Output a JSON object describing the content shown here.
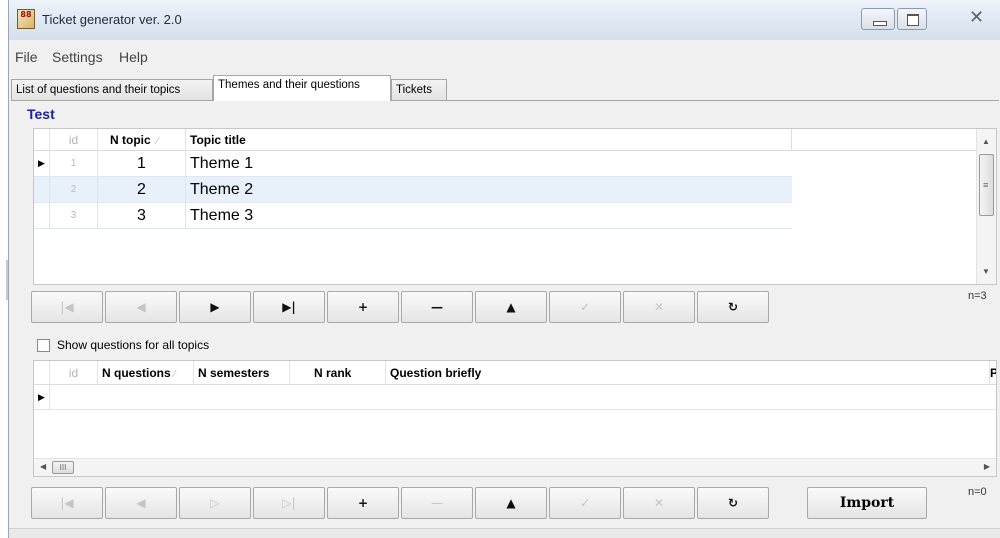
{
  "window": {
    "title": "Ticket generator ver. 2.0",
    "icon_name": "app-icon",
    "icon_text": "88",
    "controls": [
      "minimize-icon",
      "maximize-icon",
      "close-icon"
    ],
    "close_glyph": "✕"
  },
  "menu": {
    "items": [
      "File",
      "Settings",
      "Help"
    ]
  },
  "tabs": [
    {
      "label": "List of questions and their topics",
      "active": false
    },
    {
      "label": "Themes and their questions",
      "active": true
    },
    {
      "label": "Tickets",
      "active": false
    }
  ],
  "group_title": "Test",
  "topics_grid": {
    "columns": [
      {
        "key": "id",
        "label": "id"
      },
      {
        "key": "n_topic",
        "label": "N topic",
        "sort_mark": "⁄"
      },
      {
        "key": "topic_title",
        "label": "Topic title"
      }
    ],
    "rows": [
      {
        "id": "1",
        "n_topic": "1",
        "topic_title": "Theme 1",
        "current": true,
        "selected": false
      },
      {
        "id": "2",
        "n_topic": "2",
        "topic_title": "Theme 2",
        "current": false,
        "selected": true
      },
      {
        "id": "3",
        "n_topic": "3",
        "topic_title": "Theme 3",
        "current": false,
        "selected": false
      }
    ],
    "record_count": "n=3",
    "navigator": [
      {
        "name": "first-record-icon",
        "glyph": "|◀",
        "enabled": false
      },
      {
        "name": "prior-record-icon",
        "glyph": "◀",
        "enabled": false
      },
      {
        "name": "next-record-icon",
        "glyph": "▶",
        "enabled": true
      },
      {
        "name": "last-record-icon",
        "glyph": "▶|",
        "enabled": true
      },
      {
        "name": "insert-record-icon",
        "glyph": "+",
        "enabled": true
      },
      {
        "name": "delete-record-icon",
        "glyph": "—",
        "enabled": true
      },
      {
        "name": "edit-record-icon",
        "glyph": "▲",
        "enabled": true
      },
      {
        "name": "post-record-icon",
        "glyph": "✓",
        "enabled": false
      },
      {
        "name": "cancel-record-icon",
        "glyph": "✕",
        "enabled": false
      },
      {
        "name": "refresh-icon",
        "glyph": "↻",
        "enabled": true
      }
    ]
  },
  "show_all_checkbox": {
    "label": "Show questions for all topics",
    "checked": false
  },
  "questions_grid": {
    "columns": [
      {
        "key": "id",
        "label": "id"
      },
      {
        "key": "n_questions",
        "label": "N questions",
        "sort_mark": "⁄"
      },
      {
        "key": "n_semesters",
        "label": "N semesters"
      },
      {
        "key": "n_rank",
        "label": "N rank"
      },
      {
        "key": "question_briefly",
        "label": "Question briefly"
      },
      {
        "key": "p",
        "label": "P"
      }
    ],
    "rows": [],
    "scroll_thumb_glyph": "III",
    "record_count": "n=0",
    "navigator": [
      {
        "name": "first-record-icon",
        "glyph": "|◀",
        "enabled": false
      },
      {
        "name": "prior-record-icon",
        "glyph": "◀",
        "enabled": false
      },
      {
        "name": "next-record-icon",
        "glyph": "▷",
        "enabled": false
      },
      {
        "name": "last-record-icon",
        "glyph": "▷|",
        "enabled": false
      },
      {
        "name": "insert-record-icon",
        "glyph": "+",
        "enabled": true
      },
      {
        "name": "delete-record-icon",
        "glyph": "—",
        "enabled": false
      },
      {
        "name": "edit-record-icon",
        "glyph": "▲",
        "enabled": true
      },
      {
        "name": "post-record-icon",
        "glyph": "✓",
        "enabled": false
      },
      {
        "name": "cancel-record-icon",
        "glyph": "✕",
        "enabled": false
      },
      {
        "name": "refresh-icon",
        "glyph": "↻",
        "enabled": true
      }
    ],
    "import_label": "Import"
  },
  "colors": {
    "group_title": "#1b1fa0",
    "selected_row": "#e8f0fa"
  }
}
